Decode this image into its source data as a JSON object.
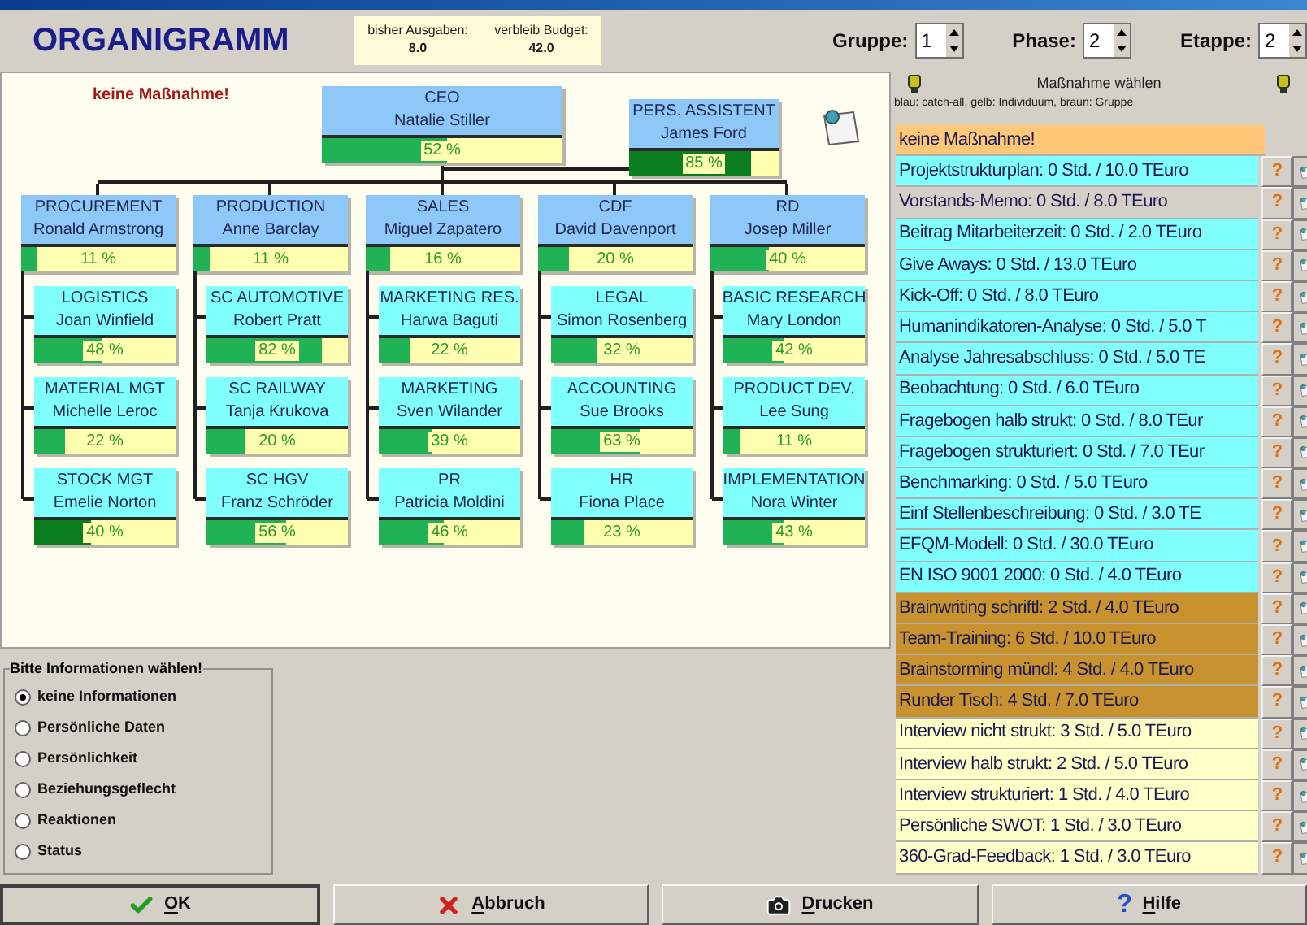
{
  "title": "ORGANIGRAMM",
  "budget": {
    "spent_label": "bisher Ausgaben:",
    "spent": "8.0",
    "remaining_label": "verbleib Budget:",
    "remaining": "42.0"
  },
  "spinners": [
    {
      "label": "Gruppe:",
      "value": "1"
    },
    {
      "label": "Phase:",
      "value": "2"
    },
    {
      "label": "Etappe:",
      "value": "2"
    }
  ],
  "chart": {
    "notice": "keine Maßnahme!",
    "ceo": {
      "title": "CEO",
      "name": "Natalie Stiller",
      "percent": "52 %",
      "level": 0.52,
      "color": "#1fb355"
    },
    "assistant": {
      "title": "PERS.  ASSISTENT",
      "name": "James Ford",
      "percent": "85 %",
      "level": 0.82,
      "color": "#0a7d1e"
    },
    "departments": [
      {
        "title": "PROCUREMENT",
        "name": "Ronald Armstrong",
        "percent": "11 %",
        "level": 0.11,
        "color": "#1fb355",
        "children": [
          {
            "title": "LOGISTICS",
            "name": "Joan Winfield",
            "percent": "48 %",
            "level": 0.48,
            "color": "#1fb355"
          },
          {
            "title": "MATERIAL MGT",
            "name": "Michelle Leroc",
            "percent": "22 %",
            "level": 0.22,
            "color": "#1fb355"
          },
          {
            "title": "STOCK MGT",
            "name": "Emelie Norton",
            "percent": "40 %",
            "level": 0.4,
            "color": "#0a7d1e"
          }
        ]
      },
      {
        "title": "PRODUCTION",
        "name": "Anne Barclay",
        "percent": "11 %",
        "level": 0.11,
        "color": "#1fb355",
        "children": [
          {
            "title": "SC AUTOMOTIVE",
            "name": "Robert Pratt",
            "percent": "82 %",
            "level": 0.82,
            "color": "#1fb355"
          },
          {
            "title": "SC RAILWAY",
            "name": "Tanja Krukova",
            "percent": "20 %",
            "level": 0.28,
            "color": "#1fb355"
          },
          {
            "title": "SC HGV",
            "name": "Franz Schröder",
            "percent": "56 %",
            "level": 0.56,
            "color": "#1fb355"
          }
        ]
      },
      {
        "title": "SALES",
        "name": "Miguel Zapatero",
        "percent": "16 %",
        "level": 0.16,
        "color": "#1fb355",
        "children": [
          {
            "title": "MARKETING RES.",
            "name": "Harwa Baguti",
            "percent": "22 %",
            "level": 0.22,
            "color": "#1fb355"
          },
          {
            "title": "MARKETING",
            "name": "Sven Wilander",
            "percent": "39 %",
            "level": 0.38,
            "color": "#1fb355"
          },
          {
            "title": "PR",
            "name": "Patricia Moldini",
            "percent": "46 %",
            "level": 0.46,
            "color": "#1fb355"
          }
        ]
      },
      {
        "title": "CDF",
        "name": "David Davenport",
        "percent": "20 %",
        "level": 0.2,
        "color": "#1fb355",
        "children": [
          {
            "title": "LEGAL",
            "name": "Simon Rosenberg",
            "percent": "32 %",
            "level": 0.32,
            "color": "#1fb355"
          },
          {
            "title": "ACCOUNTING",
            "name": "Sue Brooks",
            "percent": "63 %",
            "level": 0.63,
            "color": "#1fb355"
          },
          {
            "title": "HR",
            "name": "Fiona Place",
            "percent": "23 %",
            "level": 0.23,
            "color": "#1fb355"
          }
        ]
      },
      {
        "title": "RD",
        "name": "Josep Miller",
        "percent": "40 %",
        "level": 0.38,
        "color": "#1fb355",
        "children": [
          {
            "title": "BASIC RESEARCH",
            "name": "Mary London",
            "percent": "42 %",
            "level": 0.42,
            "color": "#1fb355"
          },
          {
            "title": "PRODUCT DEV.",
            "name": "Lee Sung",
            "percent": "11 %",
            "level": 0.11,
            "color": "#1fb355"
          },
          {
            "title": "IMPLEMENTATION",
            "name": "Nora Winter",
            "percent": "43 %",
            "level": 0.43,
            "color": "#1fb355"
          }
        ]
      }
    ]
  },
  "info_group": {
    "title": "Bitte Informationen wählen!",
    "options": [
      {
        "label": "keine Informationen",
        "selected": true
      },
      {
        "label": "Persönliche Daten",
        "selected": false
      },
      {
        "label": "Persönlichkeit",
        "selected": false
      },
      {
        "label": "Beziehungsgeflecht",
        "selected": false
      },
      {
        "label": "Reaktionen",
        "selected": false
      },
      {
        "label": "Status",
        "selected": false
      }
    ]
  },
  "measures": {
    "title": "Maßnahme wählen",
    "legend": "blau: catch-all, gelb: Individuum, braun: Gruppe",
    "items": [
      {
        "kind": "none",
        "label": "keine Maßnahme!",
        "color": "#ffc878"
      },
      {
        "kind": "measure",
        "label": "Projektstrukturplan:  0 Std. / 10.0 TEuro",
        "color": "#80ffff",
        "help": "?"
      },
      {
        "kind": "measure",
        "label": "Vorstands-Memo:  0 Std. / 8.0 TEuro",
        "color": "#d4d0c8",
        "help": "?"
      },
      {
        "kind": "measure",
        "label": "Beitrag Mitarbeiterzeit:  0 Std. / 2.0 TEuro",
        "color": "#80ffff",
        "help": "?"
      },
      {
        "kind": "measure",
        "label": "Give Aways:  0 Std. / 13.0 TEuro",
        "color": "#80ffff",
        "help": "?"
      },
      {
        "kind": "measure",
        "label": "Kick-Off:  0 Std. / 8.0 TEuro",
        "color": "#80ffff",
        "help": "?"
      },
      {
        "kind": "measure",
        "label": "Humanindikatoren-Analyse:  0 Std. / 5.0 T",
        "color": "#80ffff",
        "help": "?"
      },
      {
        "kind": "measure",
        "label": "Analyse Jahresabschluss:  0 Std. / 5.0 TE",
        "color": "#80ffff",
        "help": "?"
      },
      {
        "kind": "measure",
        "label": "Beobachtung:  0 Std. / 6.0 TEuro",
        "color": "#80ffff",
        "help": "?"
      },
      {
        "kind": "measure",
        "label": "Fragebogen halb strukt:  0 Std. / 8.0 TEur",
        "color": "#80ffff",
        "help": "?"
      },
      {
        "kind": "measure",
        "label": "Fragebogen strukturiert:  0 Std. / 7.0 TEur",
        "color": "#80ffff",
        "help": "?"
      },
      {
        "kind": "measure",
        "label": "Benchmarking:  0 Std. / 5.0 TEuro",
        "color": "#80ffff",
        "help": "?"
      },
      {
        "kind": "measure",
        "label": "Einf Stellenbeschreibung:  0 Std. / 3.0 TE",
        "color": "#80ffff",
        "help": "?"
      },
      {
        "kind": "measure",
        "label": "EFQM-Modell:  0 Std. / 30.0 TEuro",
        "color": "#80ffff",
        "help": "?"
      },
      {
        "kind": "measure",
        "label": "EN ISO 9001 2000:  0 Std. / 4.0 TEuro",
        "color": "#80ffff",
        "help": "?"
      },
      {
        "kind": "measure",
        "label": "Brainwriting schriftl:  2 Std. / 4.0 TEuro",
        "color": "#c8922e",
        "help": "?"
      },
      {
        "kind": "measure",
        "label": "Team-Training:  6 Std. / 10.0 TEuro",
        "color": "#c8922e",
        "help": "?"
      },
      {
        "kind": "measure",
        "label": "Brainstorming mündl:  4 Std. / 4.0 TEuro",
        "color": "#c8922e",
        "help": "?"
      },
      {
        "kind": "measure",
        "label": "Runder Tisch:  4 Std. / 7.0 TEuro",
        "color": "#c8922e",
        "help": "?"
      },
      {
        "kind": "measure",
        "label": "Interview nicht strukt:  3 Std. / 5.0 TEuro",
        "color": "#ffffc8",
        "help": "?"
      },
      {
        "kind": "measure",
        "label": "Interview halb strukt:  2 Std. / 5.0 TEuro",
        "color": "#ffffc8",
        "help": "?"
      },
      {
        "kind": "measure",
        "label": "Interview strukturiert:  1 Std. / 4.0 TEuro",
        "color": "#ffffc8",
        "help": "?"
      },
      {
        "kind": "measure",
        "label": "Persönliche SWOT:  1 Std. / 3.0 TEuro",
        "color": "#ffffc8",
        "help": "?"
      },
      {
        "kind": "measure",
        "label": "360-Grad-Feedback:  1 Std. / 3.0 TEuro",
        "color": "#ffffc8",
        "help": "?"
      }
    ]
  },
  "buttons": [
    {
      "kind": "ok",
      "label": "OK",
      "default": true
    },
    {
      "kind": "cancel",
      "label": "Abbruch",
      "default": false
    },
    {
      "kind": "print",
      "label": "Drucken",
      "default": false
    },
    {
      "kind": "help",
      "label": "Hilfe",
      "default": false,
      "glyph": "?"
    }
  ]
}
